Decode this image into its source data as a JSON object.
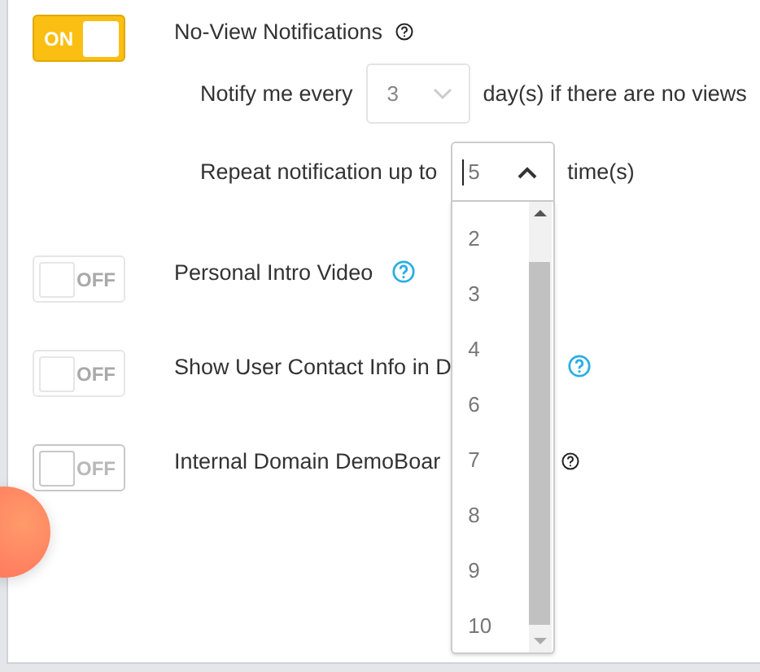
{
  "settings": [
    {
      "toggle_text": "ON",
      "on": true,
      "disabled": false,
      "label": "No-View Notifications",
      "help_highlighted": false,
      "sub_options": [
        {
          "before": "Notify me every",
          "value": "3",
          "after": "day(s) if there are no views",
          "open": false
        },
        {
          "before": "Repeat notification up to",
          "value": "5",
          "after": "time(s)",
          "open": true,
          "options": [
            "2",
            "3",
            "4",
            "6",
            "7",
            "8",
            "9",
            "10"
          ]
        }
      ]
    },
    {
      "toggle_text": "OFF",
      "on": false,
      "disabled": true,
      "label": "Personal Intro Video",
      "help_highlighted": true
    },
    {
      "toggle_text": "OFF",
      "on": false,
      "disabled": true,
      "label": "Show User Contact Info in D",
      "help_highlighted": true
    },
    {
      "toggle_text": "OFF",
      "on": false,
      "disabled": false,
      "label": "Internal Domain DemoBoar",
      "help_highlighted": false
    }
  ]
}
